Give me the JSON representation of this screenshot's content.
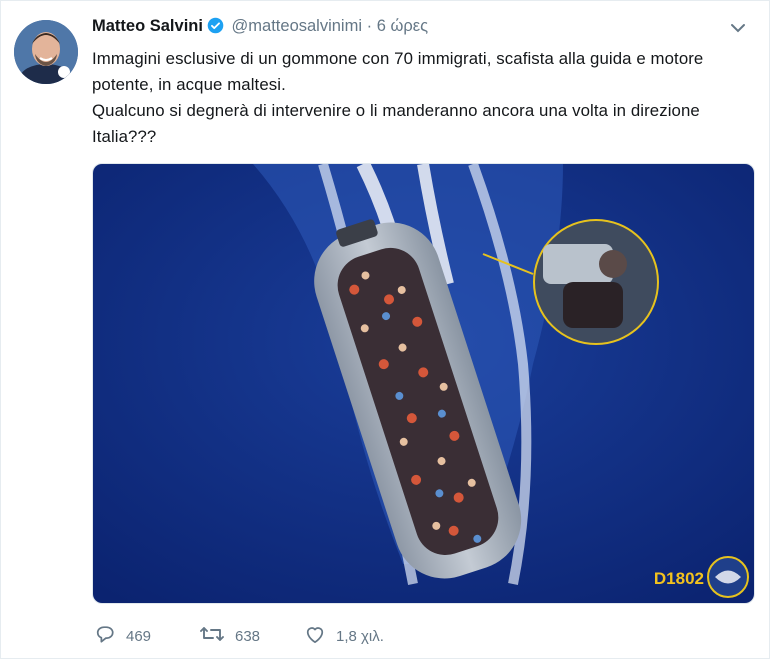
{
  "tweet": {
    "author_name": "Matteo Salvini",
    "handle": "@matteosalvinimi",
    "separator": "·",
    "time": "6 ώρες",
    "text_lines": [
      "Immagini esclusive di un gommone con 70 immigrati, scafista alla guida e motore potente, in acque maltesi.",
      "Qualcuno si degnerà di intervenire o li manderanno ancora una volta in direzione Italia???"
    ],
    "media": {
      "code": "D1802"
    },
    "actions": {
      "replies": "469",
      "retweets": "638",
      "likes": "1,8 χιλ."
    }
  },
  "colors": {
    "accent": "#1da1f2",
    "muted": "#657786",
    "sea": "#0e2a7a",
    "boat": "#a9b2bd"
  }
}
